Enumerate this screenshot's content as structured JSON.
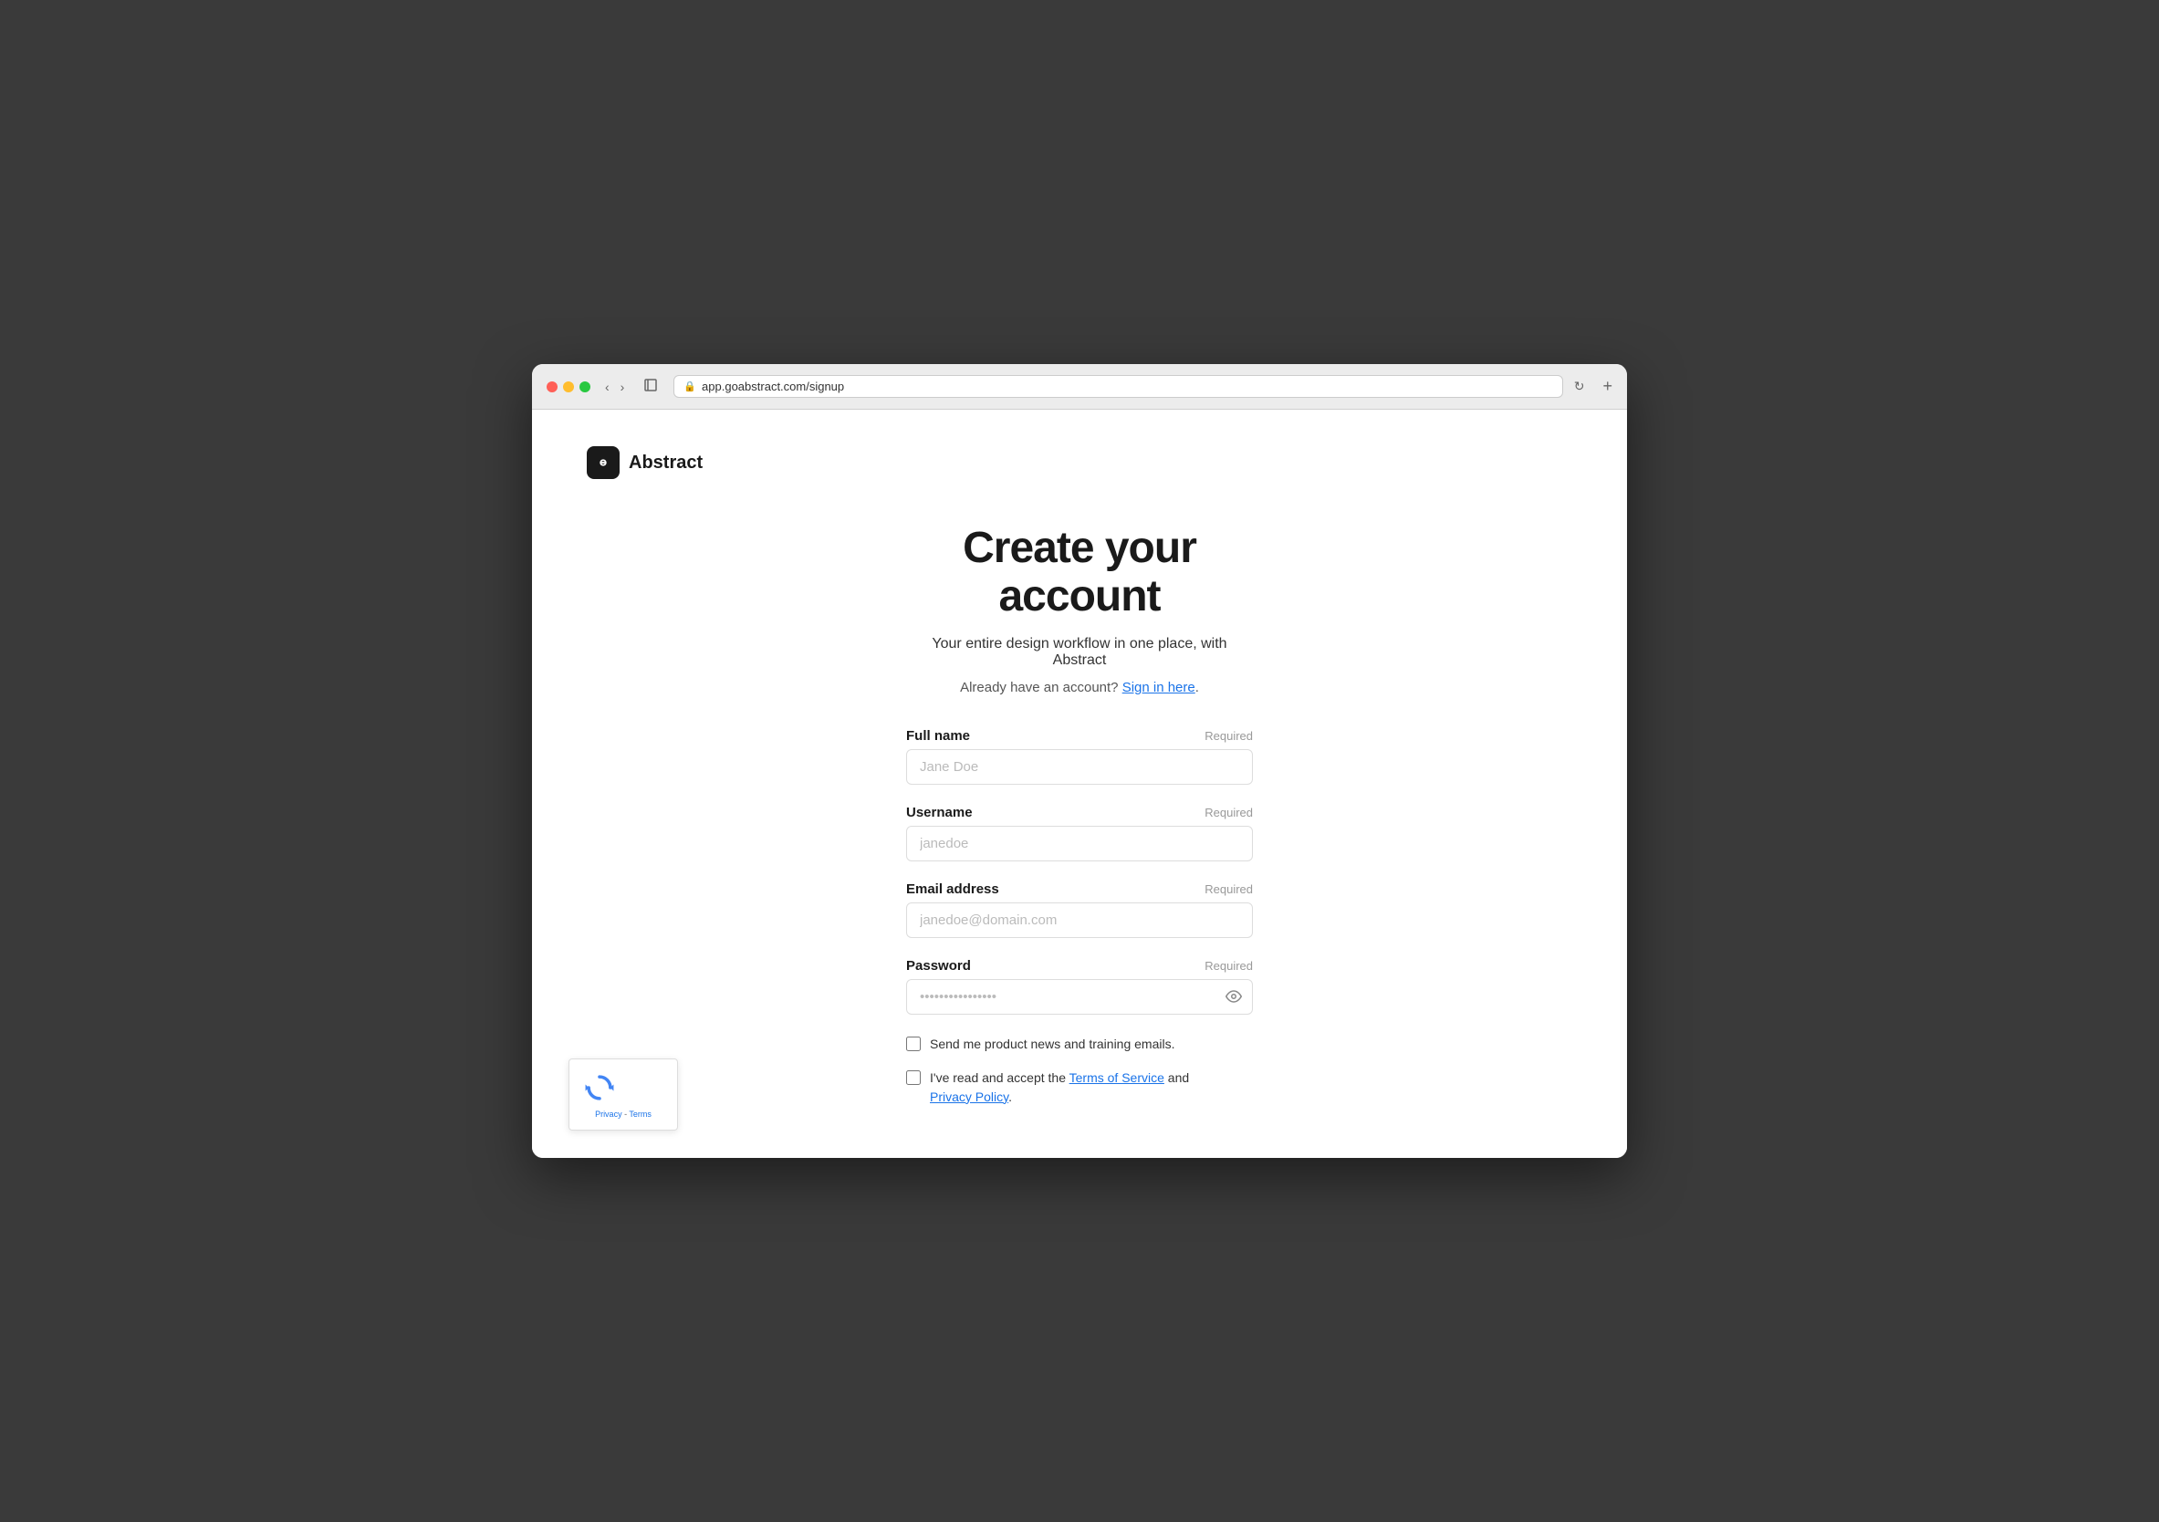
{
  "browser": {
    "url": "app.goabstract.com/signup",
    "back_btn": "‹",
    "forward_btn": "›",
    "new_tab": "+"
  },
  "logo": {
    "text": "Abstract",
    "icon_alt": "abstract-logo"
  },
  "page": {
    "title": "Create your account",
    "subtitle": "Your entire design workflow in one place, with Abstract",
    "signin_prompt": "Already have an account?",
    "signin_link": "Sign in here",
    "signin_punctuation": "."
  },
  "form": {
    "fields": [
      {
        "id": "fullname",
        "label": "Full name",
        "required": "Required",
        "placeholder": "Jane Doe",
        "type": "text",
        "value": ""
      },
      {
        "id": "username",
        "label": "Username",
        "required": "Required",
        "placeholder": "janedoe",
        "type": "text",
        "value": ""
      },
      {
        "id": "email",
        "label": "Email address",
        "required": "Required",
        "placeholder": "janedoe@domain.com",
        "type": "email",
        "value": ""
      },
      {
        "id": "password",
        "label": "Password",
        "required": "Required",
        "placeholder": "••••••••••••••••",
        "type": "password",
        "value": ""
      }
    ],
    "checkboxes": [
      {
        "id": "news",
        "label": "Send me product news and training emails.",
        "checked": false,
        "has_links": false
      },
      {
        "id": "terms",
        "label_before": "I've read and accept the ",
        "link1_text": "Terms of Service",
        "label_middle": " and ",
        "link2_text": "Privacy Policy",
        "label_after": ".",
        "checked": false,
        "has_links": true
      }
    ]
  },
  "recaptcha": {
    "privacy_text": "Privacy",
    "separator": " - ",
    "terms_text": "Terms"
  }
}
